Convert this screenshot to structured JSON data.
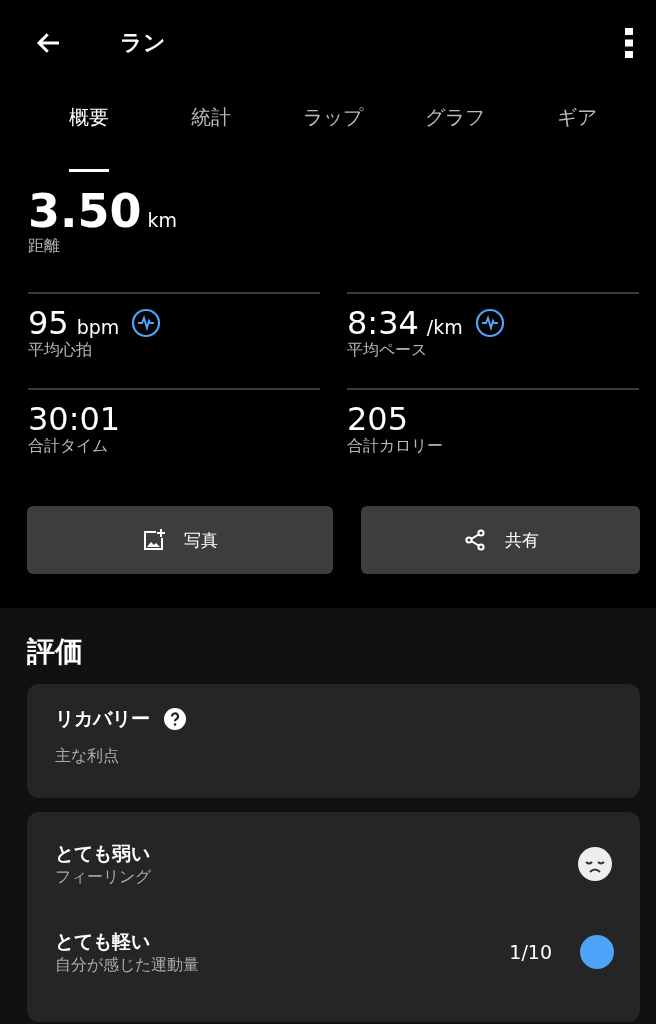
{
  "header": {
    "title": "ラン"
  },
  "tabs": [
    {
      "label": "概要",
      "selected": true
    },
    {
      "label": "統計",
      "selected": false
    },
    {
      "label": "ラップ",
      "selected": false
    },
    {
      "label": "グラフ",
      "selected": false
    },
    {
      "label": "ギア",
      "selected": false
    }
  ],
  "distance": {
    "value": "3.50",
    "unit": "km",
    "label": "距離"
  },
  "stats": [
    {
      "value": "95",
      "unit": "bpm",
      "label": "平均心拍",
      "graph_link": true
    },
    {
      "value": "8:34",
      "unit": "/km",
      "label": "平均ペース",
      "graph_link": true
    },
    {
      "value": "30:01",
      "label": "合計タイム",
      "graph_link": false
    },
    {
      "value": "205",
      "label": "合計カロリー",
      "graph_link": false
    }
  ],
  "buttons": [
    {
      "kind": "photo",
      "label": "写真"
    },
    {
      "kind": "share",
      "label": "共有"
    }
  ],
  "evaluation": {
    "title": "評価",
    "recovery": {
      "title": "リカバリー",
      "subtitle": "主な利点"
    },
    "rows": [
      {
        "kind": "feeling",
        "title": "とても弱い",
        "subtitle": "フィーリング"
      },
      {
        "kind": "effort",
        "title": "とても軽い",
        "subtitle": "自分が感じた運動量",
        "reading": "1/10",
        "color": "#4fa3f8"
      }
    ]
  }
}
